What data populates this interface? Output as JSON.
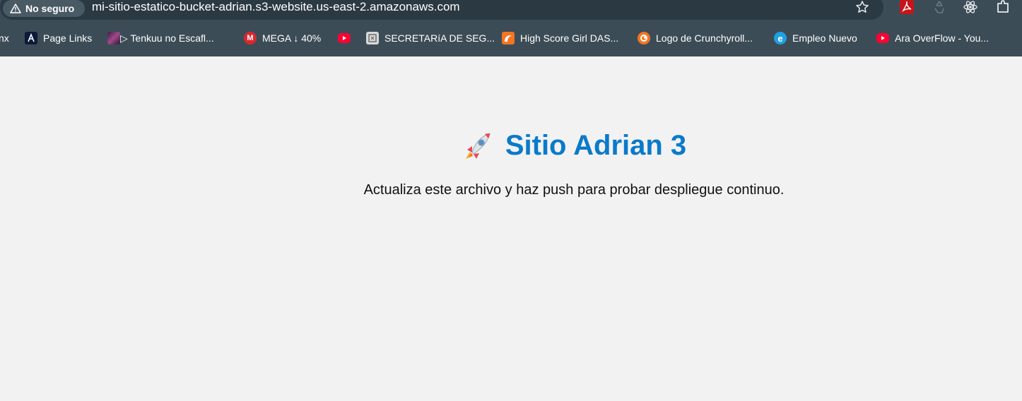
{
  "browser": {
    "security_label": "No seguro",
    "url": "mi-sitio-estatico-bucket-adrian.s3-website.us-east-2.amazonaws.com",
    "bookmarks": [
      {
        "label": "nx",
        "icon": "none"
      },
      {
        "label": "Page Links",
        "icon": "page-links-icon"
      },
      {
        "label": "▷ Tenkuu no Escafl...",
        "icon": "anime-thumb-icon"
      },
      {
        "label": "MEGA ↓ 40%",
        "icon": "mega-icon"
      },
      {
        "label": "",
        "icon": "youtube-icon"
      },
      {
        "label": "SECRETARíA DE SEG...",
        "icon": "secretaria-icon"
      },
      {
        "label": "High Score Girl DAS...",
        "icon": "crunchyroll-folder-icon"
      },
      {
        "label": "Logo de Crunchyroll...",
        "icon": "crunchyroll-icon"
      },
      {
        "label": "Empleo Nuevo",
        "icon": "edge-icon"
      },
      {
        "label": "Ara OverFlow - You...",
        "icon": "youtube-icon"
      }
    ]
  },
  "page": {
    "title": "Sitio Adrian 3",
    "title_icon": "rocket-icon",
    "description": "Actualiza este archivo y haz push para probar despliegue continuo.",
    "title_color": "#0a7acb"
  }
}
